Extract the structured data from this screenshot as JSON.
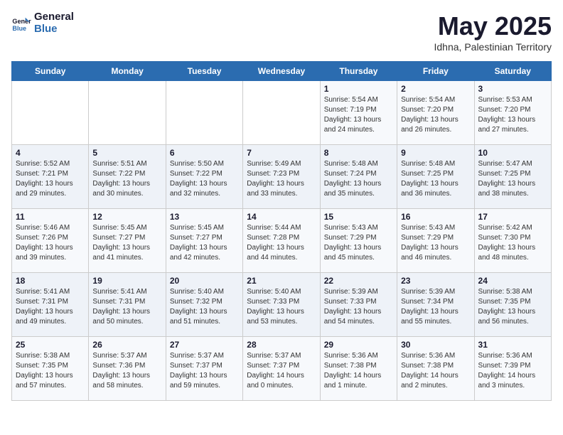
{
  "logo": {
    "line1": "General",
    "line2": "Blue"
  },
  "title": "May 2025",
  "subtitle": "Idhna, Palestinian Territory",
  "days_of_week": [
    "Sunday",
    "Monday",
    "Tuesday",
    "Wednesday",
    "Thursday",
    "Friday",
    "Saturday"
  ],
  "weeks": [
    [
      {
        "day": "",
        "detail": ""
      },
      {
        "day": "",
        "detail": ""
      },
      {
        "day": "",
        "detail": ""
      },
      {
        "day": "",
        "detail": ""
      },
      {
        "day": "1",
        "detail": "Sunrise: 5:54 AM\nSunset: 7:19 PM\nDaylight: 13 hours\nand 24 minutes."
      },
      {
        "day": "2",
        "detail": "Sunrise: 5:54 AM\nSunset: 7:20 PM\nDaylight: 13 hours\nand 26 minutes."
      },
      {
        "day": "3",
        "detail": "Sunrise: 5:53 AM\nSunset: 7:20 PM\nDaylight: 13 hours\nand 27 minutes."
      }
    ],
    [
      {
        "day": "4",
        "detail": "Sunrise: 5:52 AM\nSunset: 7:21 PM\nDaylight: 13 hours\nand 29 minutes."
      },
      {
        "day": "5",
        "detail": "Sunrise: 5:51 AM\nSunset: 7:22 PM\nDaylight: 13 hours\nand 30 minutes."
      },
      {
        "day": "6",
        "detail": "Sunrise: 5:50 AM\nSunset: 7:22 PM\nDaylight: 13 hours\nand 32 minutes."
      },
      {
        "day": "7",
        "detail": "Sunrise: 5:49 AM\nSunset: 7:23 PM\nDaylight: 13 hours\nand 33 minutes."
      },
      {
        "day": "8",
        "detail": "Sunrise: 5:48 AM\nSunset: 7:24 PM\nDaylight: 13 hours\nand 35 minutes."
      },
      {
        "day": "9",
        "detail": "Sunrise: 5:48 AM\nSunset: 7:25 PM\nDaylight: 13 hours\nand 36 minutes."
      },
      {
        "day": "10",
        "detail": "Sunrise: 5:47 AM\nSunset: 7:25 PM\nDaylight: 13 hours\nand 38 minutes."
      }
    ],
    [
      {
        "day": "11",
        "detail": "Sunrise: 5:46 AM\nSunset: 7:26 PM\nDaylight: 13 hours\nand 39 minutes."
      },
      {
        "day": "12",
        "detail": "Sunrise: 5:45 AM\nSunset: 7:27 PM\nDaylight: 13 hours\nand 41 minutes."
      },
      {
        "day": "13",
        "detail": "Sunrise: 5:45 AM\nSunset: 7:27 PM\nDaylight: 13 hours\nand 42 minutes."
      },
      {
        "day": "14",
        "detail": "Sunrise: 5:44 AM\nSunset: 7:28 PM\nDaylight: 13 hours\nand 44 minutes."
      },
      {
        "day": "15",
        "detail": "Sunrise: 5:43 AM\nSunset: 7:29 PM\nDaylight: 13 hours\nand 45 minutes."
      },
      {
        "day": "16",
        "detail": "Sunrise: 5:43 AM\nSunset: 7:29 PM\nDaylight: 13 hours\nand 46 minutes."
      },
      {
        "day": "17",
        "detail": "Sunrise: 5:42 AM\nSunset: 7:30 PM\nDaylight: 13 hours\nand 48 minutes."
      }
    ],
    [
      {
        "day": "18",
        "detail": "Sunrise: 5:41 AM\nSunset: 7:31 PM\nDaylight: 13 hours\nand 49 minutes."
      },
      {
        "day": "19",
        "detail": "Sunrise: 5:41 AM\nSunset: 7:31 PM\nDaylight: 13 hours\nand 50 minutes."
      },
      {
        "day": "20",
        "detail": "Sunrise: 5:40 AM\nSunset: 7:32 PM\nDaylight: 13 hours\nand 51 minutes."
      },
      {
        "day": "21",
        "detail": "Sunrise: 5:40 AM\nSunset: 7:33 PM\nDaylight: 13 hours\nand 53 minutes."
      },
      {
        "day": "22",
        "detail": "Sunrise: 5:39 AM\nSunset: 7:33 PM\nDaylight: 13 hours\nand 54 minutes."
      },
      {
        "day": "23",
        "detail": "Sunrise: 5:39 AM\nSunset: 7:34 PM\nDaylight: 13 hours\nand 55 minutes."
      },
      {
        "day": "24",
        "detail": "Sunrise: 5:38 AM\nSunset: 7:35 PM\nDaylight: 13 hours\nand 56 minutes."
      }
    ],
    [
      {
        "day": "25",
        "detail": "Sunrise: 5:38 AM\nSunset: 7:35 PM\nDaylight: 13 hours\nand 57 minutes."
      },
      {
        "day": "26",
        "detail": "Sunrise: 5:37 AM\nSunset: 7:36 PM\nDaylight: 13 hours\nand 58 minutes."
      },
      {
        "day": "27",
        "detail": "Sunrise: 5:37 AM\nSunset: 7:37 PM\nDaylight: 13 hours\nand 59 minutes."
      },
      {
        "day": "28",
        "detail": "Sunrise: 5:37 AM\nSunset: 7:37 PM\nDaylight: 14 hours\nand 0 minutes."
      },
      {
        "day": "29",
        "detail": "Sunrise: 5:36 AM\nSunset: 7:38 PM\nDaylight: 14 hours\nand 1 minute."
      },
      {
        "day": "30",
        "detail": "Sunrise: 5:36 AM\nSunset: 7:38 PM\nDaylight: 14 hours\nand 2 minutes."
      },
      {
        "day": "31",
        "detail": "Sunrise: 5:36 AM\nSunset: 7:39 PM\nDaylight: 14 hours\nand 3 minutes."
      }
    ]
  ]
}
